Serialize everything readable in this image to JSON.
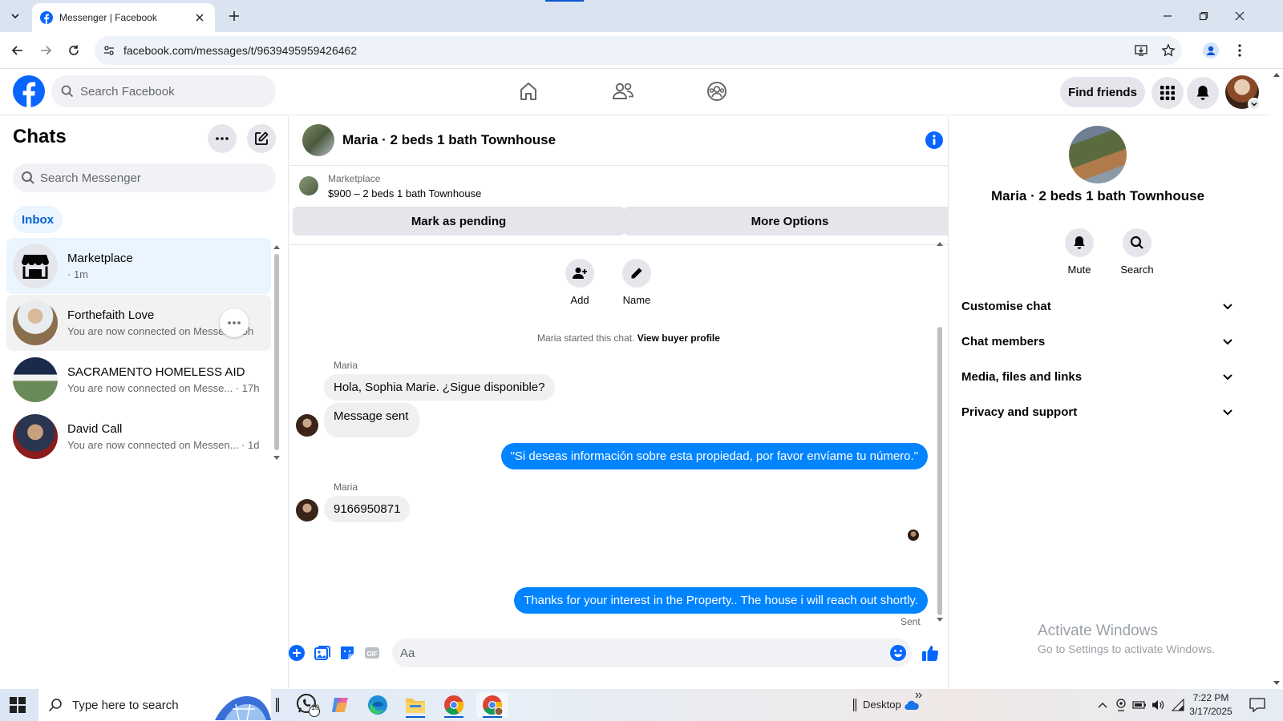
{
  "browser": {
    "tab_title": "Messenger | Facebook",
    "url": "facebook.com/messages/t/9639495959426462"
  },
  "fb": {
    "search_placeholder": "Search Facebook",
    "find_friends": "Find friends"
  },
  "sidebar": {
    "title": "Chats",
    "search_placeholder": "Search Messenger",
    "inbox_label": "Inbox",
    "chats": [
      {
        "name": "Marketplace",
        "preview": "· 1m"
      },
      {
        "name": "Forthefaith Love",
        "preview": "You are now connected on Messe... · 5h"
      },
      {
        "name": "SACRAMENTO HOMELESS AID",
        "preview": "You are now connected on Messe... · 17h"
      },
      {
        "name": "David Call",
        "preview": "You are now connected on Messen... · 1d"
      }
    ]
  },
  "conversation": {
    "title": "Maria · 2 beds 1 bath Townhouse",
    "marketplace_label": "Marketplace",
    "listing": "$900 – 2 beds 1 bath Townhouse",
    "mark_pending": "Mark as pending",
    "more_options": "More Options",
    "add_label": "Add",
    "name_label": "Name",
    "started_text": "Maria started this chat.",
    "view_profile": "View buyer profile",
    "messages": [
      {
        "sender": "Maria",
        "text": "Hola, Sophia Marie. ¿Sigue disponible?"
      },
      {
        "text": "Message sent"
      },
      {
        "text": "\"Si deseas información sobre esta propiedad, por favor envíame tu número.\""
      },
      {
        "sender": "Maria",
        "text": "9166950871"
      },
      {
        "text": "Thanks for your interest in the Property.. The house i will reach  out shortly."
      }
    ],
    "sent_label": "Sent",
    "composer_placeholder": "Aa"
  },
  "details": {
    "name": "Maria · 2 beds 1 bath Townhouse",
    "mute": "Mute",
    "search": "Search",
    "sections": [
      "Customise chat",
      "Chat members",
      "Media, files and links",
      "Privacy and support"
    ]
  },
  "watermark": {
    "line1": "Activate Windows",
    "line2": "Go to Settings to activate Windows."
  },
  "taskbar": {
    "search_placeholder": "Type here to search",
    "whatsapp_badge": "10",
    "desktop_label": "Desktop",
    "time": "7:22 PM",
    "date": "3/17/2025"
  },
  "colors": {
    "fb_blue": "#0866ff",
    "messenger_blue": "#0084ff"
  }
}
